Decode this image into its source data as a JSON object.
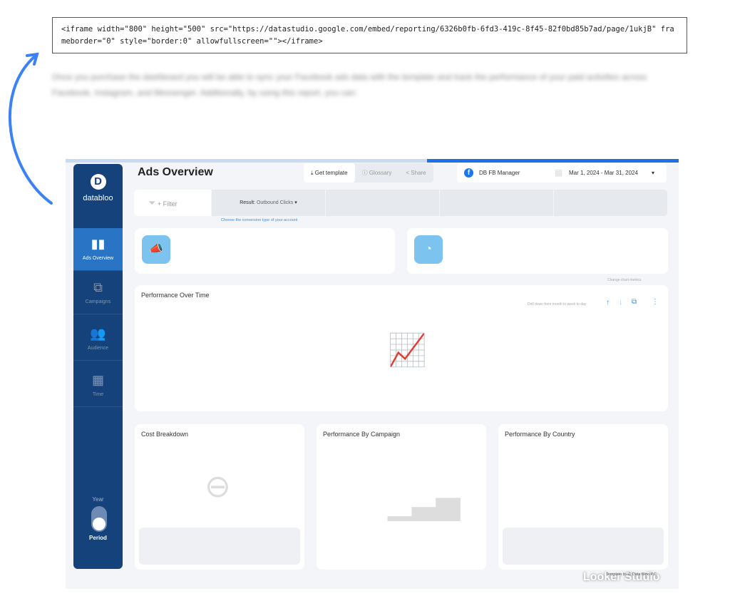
{
  "embed_code": "<iframe width=\"800\" height=\"500\" src=\"https://datastudio.google.com/embed/reporting/6326b0fb-6fd3-419c-8f45-82f0bd85b7ad/page/1ukjB\" frameborder=\"0\" style=\"border:0\" allowfullscreen=\"\"></iframe>",
  "blurred_text": "Once you purchase the dashboard you will be able to sync your Facebook ads data with the template and track the performance of your paid activities across Facebook, Instagram, and Messenger. Additionally, by using this report, you can:",
  "sidebar": {
    "brand": "databloo",
    "items": [
      {
        "label": "Ads Overview",
        "icon": "bar-chart-icon"
      },
      {
        "label": "Campaigns",
        "icon": "hierarchy-icon"
      },
      {
        "label": "Audience",
        "icon": "users-icon"
      },
      {
        "label": "Time",
        "icon": "calendar-icon"
      }
    ],
    "toggle_top": "Year",
    "toggle_bottom": "Period"
  },
  "header": {
    "title": "Ads Overview",
    "get_template": "Get template",
    "glossary": "Glossary",
    "share": "Share",
    "account": "DB FB Manager",
    "date_range": "Mar 1, 2024 - Mar 31, 2024"
  },
  "filters": {
    "add_filter": "+ Filter",
    "result_label": "Result:",
    "result_value": "Outbound Clicks",
    "hint": "Choose the conversion type of your account"
  },
  "chart": {
    "title": "Performance Over Time",
    "drill_hint": "Drill down from month to week to day",
    "metrics_hint": "Change chart metrics"
  },
  "panels": [
    "Cost Breakdown",
    "Performance By Campaign",
    "Performance By Country"
  ],
  "footer": {
    "credit": "Template by © Data Bloo P.C.",
    "watermark": "Looker Studio"
  },
  "colors": {
    "sidebar": "#15427a",
    "accent": "#2a74c6",
    "kpi_icon": "#7cc3f0",
    "arrow": "#3b82f6"
  }
}
